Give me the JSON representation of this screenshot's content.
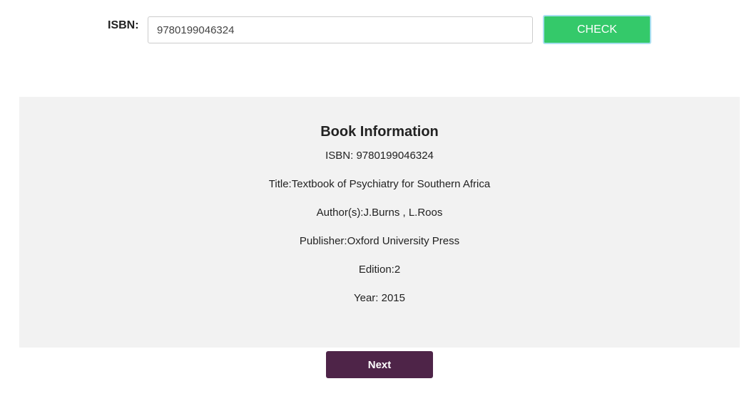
{
  "form": {
    "isbn_label": "ISBN:",
    "isbn_value": "9780199046324",
    "check_label": "CHECK"
  },
  "book_info": {
    "heading": "Book Information",
    "isbn": "ISBN: 9780199046324",
    "title": "Title:Textbook of Psychiatry for Southern Africa",
    "authors": "Author(s):J.Burns , L.Roos",
    "publisher": "Publisher:Oxford University Press",
    "edition": "Edition:2",
    "year": "Year: 2015"
  },
  "actions": {
    "next_label": "Next"
  },
  "colors": {
    "check_button": "#34c96a",
    "next_button": "#4e2448",
    "panel_background": "#f2f2f2"
  }
}
